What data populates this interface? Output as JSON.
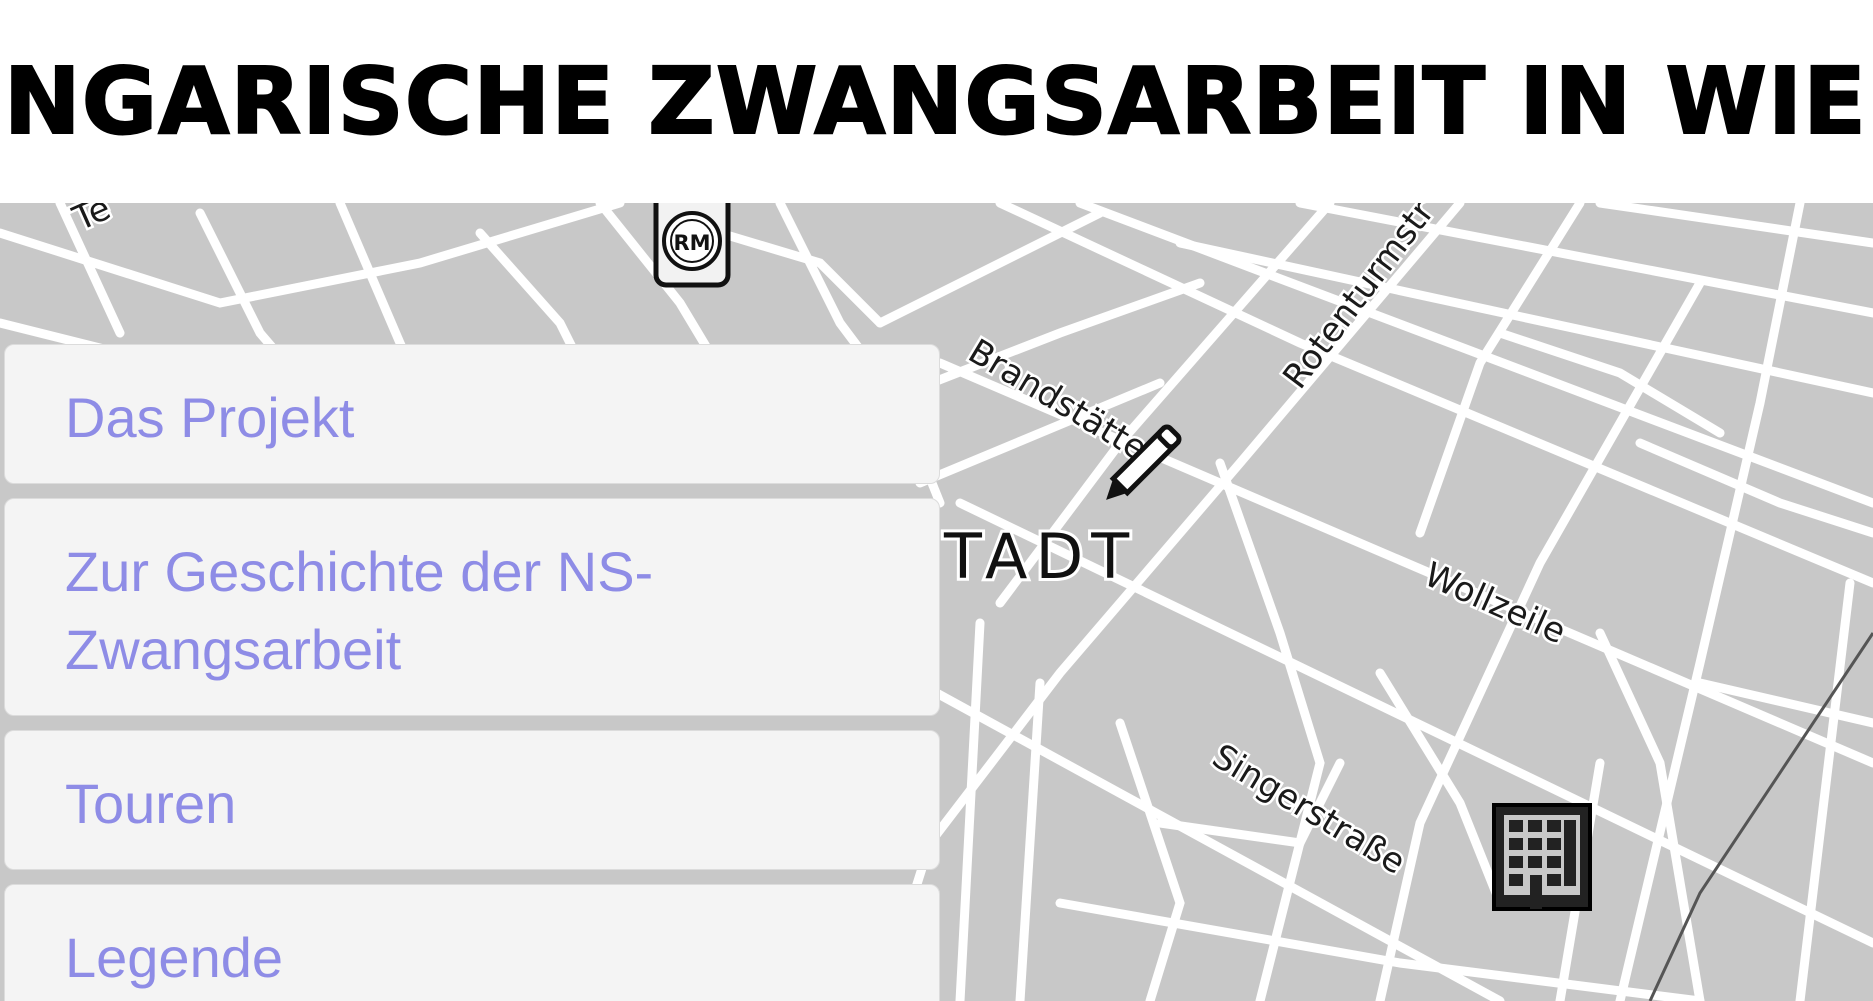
{
  "header": {
    "title": "UNGARISCHE ZWANGSARBEIT IN WIEN"
  },
  "menu": {
    "items": [
      {
        "label": "Das Projekt"
      },
      {
        "label": "Zur Geschichte der NS-Zwangsarbeit"
      },
      {
        "label": "Touren"
      },
      {
        "label": "Legende"
      }
    ]
  },
  "map": {
    "district_label": "TADT",
    "streets": {
      "brandstaette": "Brandstätte",
      "rotenturm": "Rotenturmstr",
      "wollzeile": "Wollzeile",
      "singerstrasse": "Singerstraße",
      "partial_top_left": "Te"
    },
    "markers": [
      {
        "icon": "rm-badge-icon",
        "text": "RM"
      },
      {
        "icon": "pencil-icon"
      },
      {
        "icon": "building-icon"
      }
    ]
  },
  "colors": {
    "map_background": "#c8c8c8",
    "street": "#ffffff",
    "menu_background": "#f4f4f4",
    "menu_text": "#8e8ce6",
    "title": "#000000"
  }
}
